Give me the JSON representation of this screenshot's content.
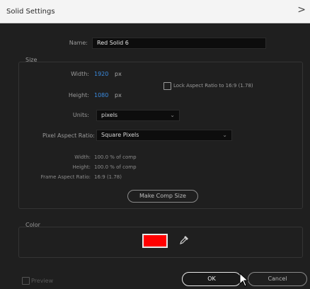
{
  "window": {
    "title": "Solid Settings",
    "close_glyph": ">"
  },
  "name": {
    "label": "Name:",
    "value": "Red Solid 6"
  },
  "size": {
    "section_label": "Size",
    "width_label": "Width:",
    "width_value": "1920",
    "width_unit": "px",
    "height_label": "Height:",
    "height_value": "1080",
    "height_unit": "px",
    "lock_aspect_label": "Lock Aspect Ratio to 16:9 (1.78)",
    "lock_aspect_checked": false,
    "units_label": "Units:",
    "units_value": "pixels",
    "par_label": "Pixel Aspect Ratio:",
    "par_value": "Square Pixels",
    "info": {
      "width_label": "Width:",
      "width_value": "100.0 % of comp",
      "height_label": "Height:",
      "height_value": "100.0 % of comp",
      "frame_label": "Frame Aspect Ratio:",
      "frame_value": "16:9 (1.78)"
    },
    "make_comp_size_label": "Make Comp Size"
  },
  "color": {
    "section_label": "Color",
    "swatch_hex": "#ff0000"
  },
  "footer": {
    "preview_label": "Preview",
    "preview_checked": false,
    "ok_label": "OK",
    "cancel_label": "Cancel"
  }
}
